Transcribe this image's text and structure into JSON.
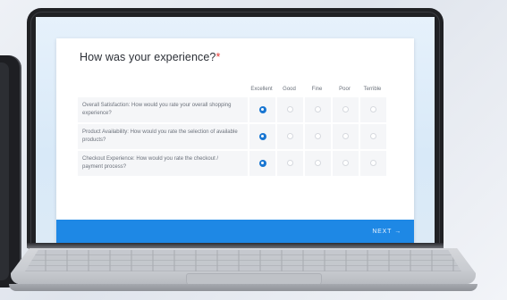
{
  "form": {
    "question": "How was your experience?",
    "required_marker": "*",
    "columns": [
      "Excellent",
      "Good",
      "Fine",
      "Poor",
      "Terrible"
    ],
    "rows": [
      {
        "label": "Overall Satisfaction: How would you rate your overall shopping experience?",
        "selected": "Excellent"
      },
      {
        "label": "Product Availability: How would you rate the selection of available products?",
        "selected": "Excellent"
      },
      {
        "label": "Checkout Experience: How would you rate the checkout / payment process?",
        "selected": "Excellent"
      }
    ],
    "next_label": "NEXT",
    "next_icon": "→"
  },
  "colors": {
    "accent": "#1e88e5",
    "selected_radio": "#1976d2",
    "required": "#e53935"
  }
}
